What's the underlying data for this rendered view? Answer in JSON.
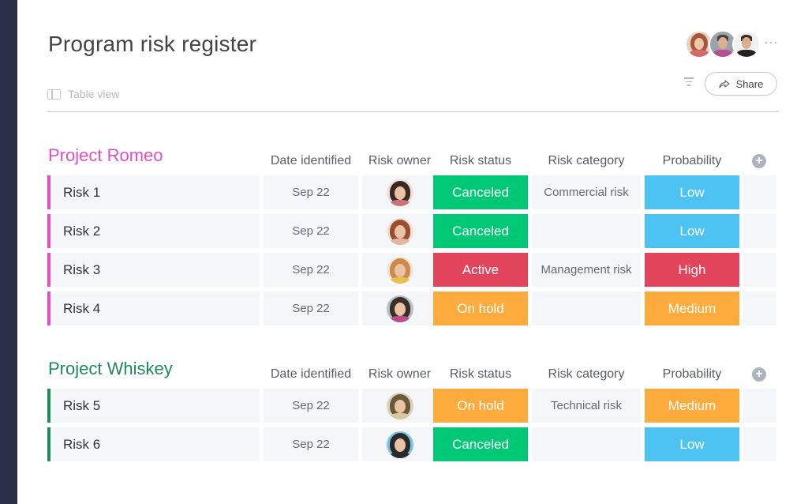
{
  "board": {
    "title": "Program risk register",
    "view_label": "Table view",
    "share_label": "Share",
    "more_label": "⋯",
    "icons": [
      "table-view-icon",
      "filter-icon",
      "share-arrow-icon",
      "more-dots-icon",
      "add-column-icon"
    ]
  },
  "members": [
    {
      "hair": "#a8573a",
      "bg": "#e7d2c6",
      "shirt": "#d46a6a"
    },
    {
      "hair": "#4a3f3a",
      "bg": "#9aa3ad",
      "shirt": "#b84f8e"
    },
    {
      "hair": "#3b2b24",
      "bg": "#f1f1f1",
      "shirt": "#222222"
    }
  ],
  "columns": {
    "date": "Date identified",
    "owner": "Risk owner",
    "status": "Risk status",
    "category": "Risk category",
    "probability": "Probability"
  },
  "colors": {
    "romeo": "#e44fbf",
    "whiskey": "#1f8a5b",
    "canceled": "#00c875",
    "active": "#e2445c",
    "on_hold": "#fdab3d",
    "low": "#4dc3f2",
    "high": "#e2445c",
    "medium": "#fdab3d"
  },
  "groups": [
    {
      "title": "Project Romeo",
      "rows": [
        {
          "name": "Risk 1",
          "date": "Sep 22",
          "status": "Canceled",
          "category": "Commercial risk",
          "probability": "Low"
        },
        {
          "name": "Risk 2",
          "date": "Sep 22",
          "status": "Canceled",
          "category": "",
          "probability": "Low"
        },
        {
          "name": "Risk 3",
          "date": "Sep 22",
          "status": "Active",
          "category": "Management risk",
          "probability": "High"
        },
        {
          "name": "Risk 4",
          "date": "Sep 22",
          "status": "On hold",
          "category": "",
          "probability": "Medium"
        }
      ]
    },
    {
      "title": "Project Whiskey",
      "rows": [
        {
          "name": "Risk 5",
          "date": "Sep 22",
          "status": "On hold",
          "category": "Technical risk",
          "probability": "Medium"
        },
        {
          "name": "Risk 6",
          "date": "Sep 22",
          "status": "Canceled",
          "category": "",
          "probability": "Low"
        }
      ]
    }
  ]
}
